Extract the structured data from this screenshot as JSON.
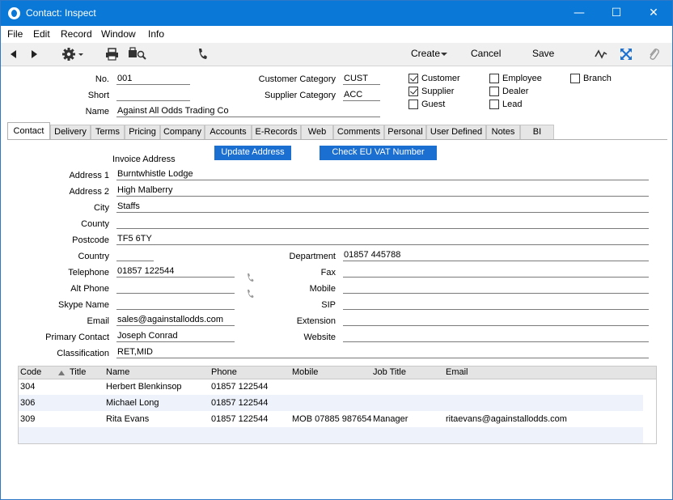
{
  "window": {
    "title": "Contact: Inspect",
    "controls": {
      "minimize": "—",
      "maximize": "☐",
      "close": "✕"
    }
  },
  "menu": [
    "File",
    "Edit",
    "Record",
    "Window",
    "Info"
  ],
  "toolbar": {
    "create_label": "Create",
    "cancel_label": "Cancel",
    "save_label": "Save",
    "icons": [
      "back-icon",
      "forward-icon",
      "gear-icon",
      "print-icon",
      "print-preview-icon",
      "phone-icon",
      "activity-icon",
      "expand-icon",
      "attachment-icon"
    ]
  },
  "header": {
    "no_label": "No.",
    "no_value": "001",
    "short_label": "Short",
    "short_value": "",
    "name_label": "Name",
    "name_value": "Against All Odds Trading Co",
    "customer_category_label": "Customer Category",
    "customer_category_value": "CUST",
    "supplier_category_label": "Supplier Category",
    "supplier_category_value": "ACC",
    "checkboxes": [
      {
        "label": "Customer",
        "checked": true
      },
      {
        "label": "Supplier",
        "checked": true
      },
      {
        "label": "Guest",
        "checked": false
      },
      {
        "label": "Employee",
        "checked": false
      },
      {
        "label": "Dealer",
        "checked": false
      },
      {
        "label": "Lead",
        "checked": false
      },
      {
        "label": "Branch",
        "checked": false
      }
    ]
  },
  "tabs": [
    "Contact",
    "Delivery",
    "Terms",
    "Pricing",
    "Company",
    "Accounts",
    "E-Records",
    "Web",
    "Comments",
    "Personal",
    "User Defined",
    "Notes",
    "BI"
  ],
  "active_tab": "Contact",
  "contact": {
    "invoice_address_label": "Invoice Address",
    "update_address_button": "Update Address",
    "check_vat_button": "Check EU VAT Number",
    "address1_label": "Address 1",
    "address1_value": "Burntwhistle Lodge",
    "address2_label": "Address 2",
    "address2_value": "High Malberry",
    "city_label": "City",
    "city_value": "Staffs",
    "county_label": "County",
    "county_value": "",
    "postcode_label": "Postcode",
    "postcode_value": "TF5 6TY",
    "country_label": "Country",
    "country_value": "",
    "telephone_label": "Telephone",
    "telephone_value": "01857 122544",
    "alt_phone_label": "Alt Phone",
    "alt_phone_value": "",
    "skype_label": "Skype Name",
    "skype_value": "",
    "email_label": "Email",
    "email_value": "sales@againstallodds.com",
    "primary_contact_label": "Primary Contact",
    "primary_contact_value": "Joseph Conrad",
    "classification_label": "Classification",
    "classification_value": "RET,MID",
    "department_label": "Department",
    "department_value": "01857 445788",
    "fax_label": "Fax",
    "fax_value": "",
    "mobile_label": "Mobile",
    "mobile_value": "",
    "sip_label": "SIP",
    "sip_value": "",
    "extension_label": "Extension",
    "extension_value": "",
    "website_label": "Website",
    "website_value": ""
  },
  "contacts_table": {
    "columns": [
      "Code",
      "Title",
      "Name",
      "Phone",
      "Mobile",
      "Job Title",
      "Email"
    ],
    "rows": [
      [
        "304",
        "",
        "Herbert Blenkinsop",
        "01857 122544",
        "",
        "",
        ""
      ],
      [
        "306",
        "",
        "Michael Long",
        "01857 122544",
        "",
        "",
        ""
      ],
      [
        "309",
        "",
        "Rita Evans",
        "01857 122544",
        "MOB 07885 987654",
        "Manager",
        "ritaevans@againstallodds.com"
      ]
    ]
  }
}
